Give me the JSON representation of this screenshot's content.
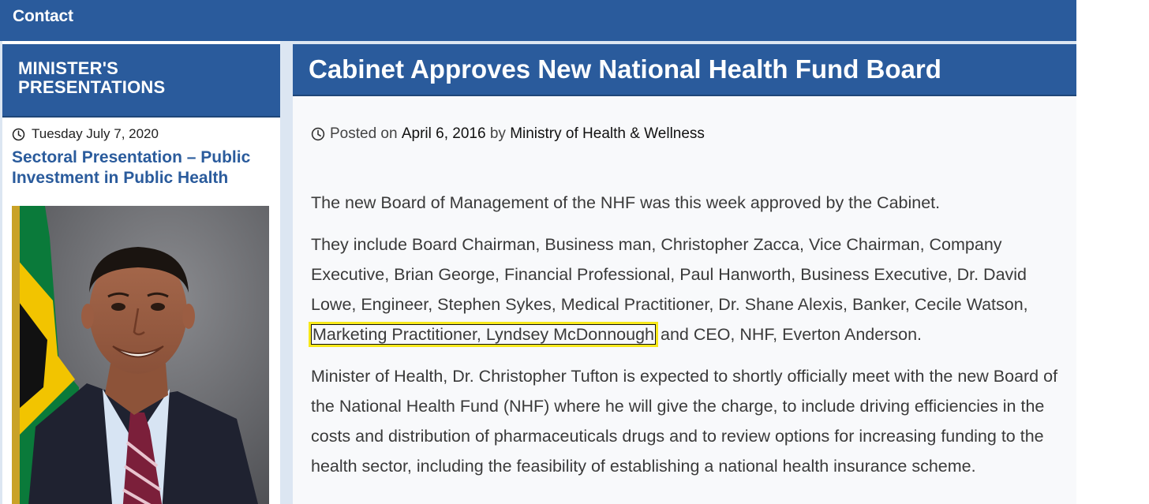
{
  "nav": {
    "contact_label": "Contact"
  },
  "sidebar": {
    "section_title": "MINISTER'S PRESENTATIONS",
    "presentation": {
      "date": "Tuesday July 7, 2020",
      "title": "Sectoral Presentation – Public Investment in Public Health"
    }
  },
  "article": {
    "title": "Cabinet Approves New National Health Fund Board",
    "meta": {
      "posted_prefix": "Posted on",
      "date": "April 6, 2016",
      "by_text": "by",
      "author": "Ministry of Health & Wellness"
    },
    "paragraphs": {
      "p1": "The new Board of Management of the NHF was this week approved by the Cabinet.",
      "p2_before": "They include Board Chairman, Business man, Christopher Zacca, Vice Chairman, Company Executive, Brian George, Financial Professional, Paul Hanworth, Business Executive, Dr. David Lowe, Engineer, Stephen Sykes, Medical Practitioner, Dr. Shane Alexis, Banker, Cecile Watson, ",
      "p2_highlight": "Marketing Practitioner, Lyndsey McDonnough",
      "p2_after": " and CEO, NHF, Everton Anderson.",
      "p3": "Minister of Health, Dr. Christopher Tufton is expected to shortly officially meet with the new Board of the National Health Fund (NHF) where he will give the charge, to include driving efficiencies in the costs and distribution of pharmaceuticals drugs and to review options for increasing funding to the health sector, including the feasibility of establishing a national health insurance scheme."
    }
  },
  "icons": {
    "clock": "clock-icon"
  },
  "colors": {
    "brand_blue": "#2a5b9c",
    "highlight_yellow": "#f7e81a",
    "link_blue": "#2a5b9c"
  }
}
